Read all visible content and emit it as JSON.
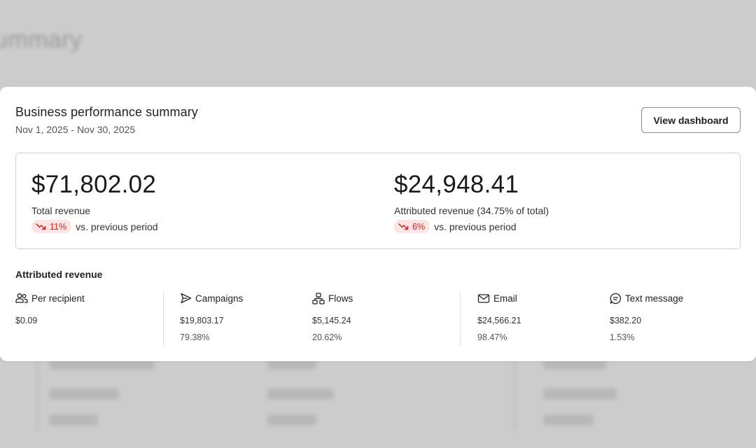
{
  "background": {
    "title_fragment": "ummary"
  },
  "card": {
    "title": "Business performance summary",
    "date_range": "Nov 1, 2025 - Nov 30, 2025",
    "view_button": "View dashboard"
  },
  "summary": {
    "total": {
      "value": "$71,802.02",
      "label": "Total revenue",
      "change": "11%",
      "change_direction": "down",
      "change_suffix": "vs. previous period"
    },
    "attributed": {
      "value": "$24,948.41",
      "label": "Attributed revenue (34.75% of total)",
      "change": "6%",
      "change_direction": "down",
      "change_suffix": "vs. previous period"
    }
  },
  "attributed_section": {
    "title": "Attributed revenue",
    "stats": [
      {
        "icon": "people-icon",
        "label": "Per recipient",
        "value": "$0.09",
        "percent": ""
      },
      {
        "icon": "send-icon",
        "label": "Campaigns",
        "value": "$19,803.17",
        "percent": "79.38%"
      },
      {
        "icon": "flow-icon",
        "label": "Flows",
        "value": "$5,145.24",
        "percent": "20.62%"
      },
      {
        "icon": "mail-icon",
        "label": "Email",
        "value": "$24,566.21",
        "percent": "98.47%"
      },
      {
        "icon": "message-icon",
        "label": "Text message",
        "value": "$382.20",
        "percent": "1.53%"
      }
    ]
  },
  "colors": {
    "negative_badge_bg": "#fde3e3",
    "negative_badge_text": "#c4271e",
    "card_bg": "#ffffff",
    "overlay_bg": "#cccccc"
  }
}
